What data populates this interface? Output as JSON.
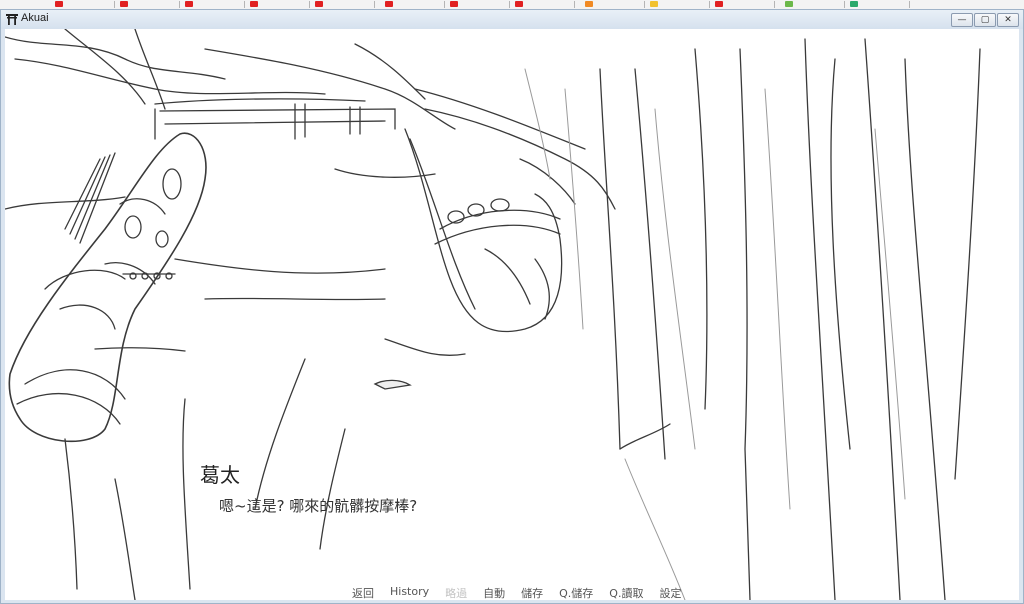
{
  "window": {
    "title": "Akuai",
    "controls": {
      "minimize": "—",
      "maximize": "▢",
      "close": "✕"
    }
  },
  "dialogue": {
    "speaker": "葛太",
    "text": "嗯~這是? 哪來的骯髒按摩棒?"
  },
  "quick_menu": [
    {
      "label": "返回",
      "enabled": true
    },
    {
      "label": "History",
      "enabled": true
    },
    {
      "label": "略過",
      "enabled": false
    },
    {
      "label": "自動",
      "enabled": true
    },
    {
      "label": "儲存",
      "enabled": true
    },
    {
      "label": "Q.儲存",
      "enabled": true
    },
    {
      "label": "Q.讀取",
      "enabled": true
    },
    {
      "label": "設定",
      "enabled": true
    }
  ],
  "colors": {
    "accent_tab": "#e02020",
    "frame": "#9fb3c8",
    "scene_bg": "#ffffff",
    "disabled_text": "#c4c4c4"
  },
  "icons": {
    "app": "torii-icon",
    "tab": "browser-tab-icon"
  }
}
